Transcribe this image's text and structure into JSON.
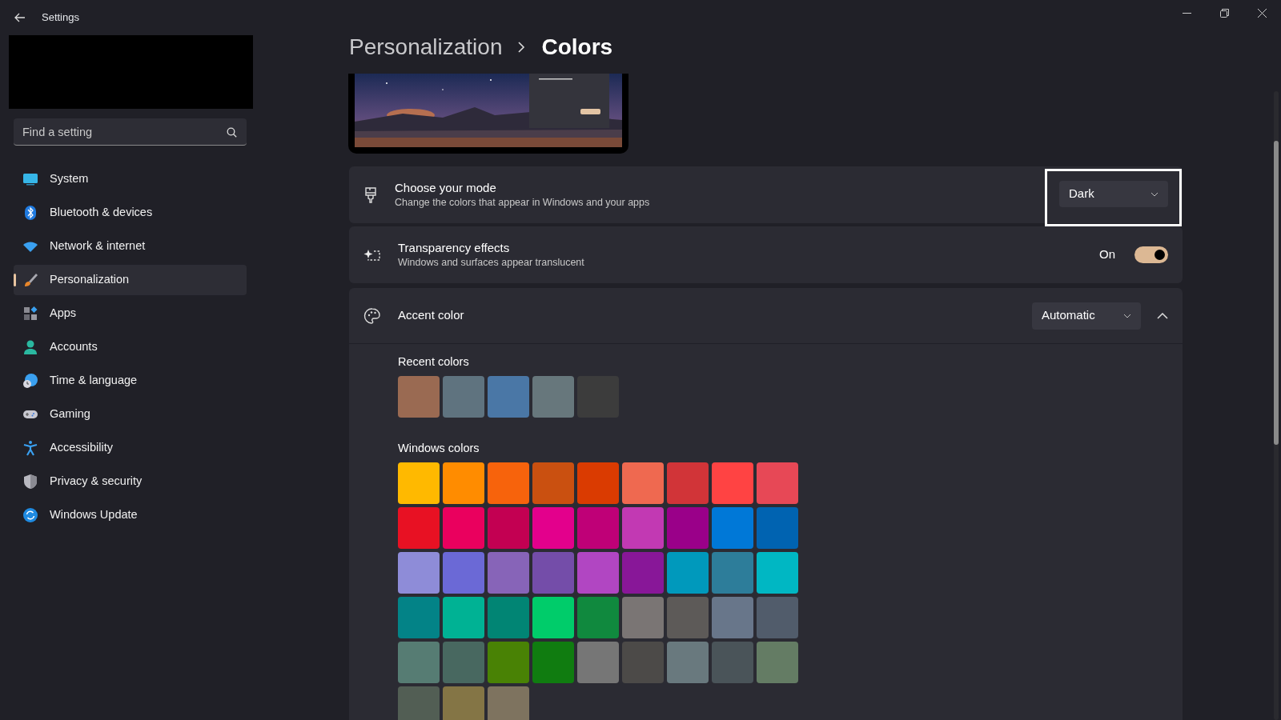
{
  "window": {
    "title": "Settings"
  },
  "search": {
    "placeholder": "Find a setting"
  },
  "nav": [
    {
      "label": "System",
      "selected": false
    },
    {
      "label": "Bluetooth & devices",
      "selected": false
    },
    {
      "label": "Network & internet",
      "selected": false
    },
    {
      "label": "Personalization",
      "selected": true
    },
    {
      "label": "Apps",
      "selected": false
    },
    {
      "label": "Accounts",
      "selected": false
    },
    {
      "label": "Time & language",
      "selected": false
    },
    {
      "label": "Gaming",
      "selected": false
    },
    {
      "label": "Accessibility",
      "selected": false
    },
    {
      "label": "Privacy & security",
      "selected": false
    },
    {
      "label": "Windows Update",
      "selected": false
    }
  ],
  "breadcrumb": [
    "Personalization",
    "Colors"
  ],
  "settings": [
    {
      "kind": "dropdown",
      "title": "Choose your mode",
      "description": "Change the colors that appear in Windows and your apps",
      "value": "Dark",
      "highlighted": true
    },
    {
      "kind": "toggle",
      "title": "Transparency effects",
      "description": "Windows and surfaces appear translucent",
      "state_label": "On",
      "on": true
    }
  ],
  "accent": {
    "title": "Accent color",
    "value": "Automatic",
    "expanded": true,
    "recent_label": "Recent colors",
    "recent": [
      {
        "color": "#9a6a52"
      },
      {
        "color": "#5f737f"
      },
      {
        "color": "#4a77a6"
      },
      {
        "color": "#67777c"
      },
      {
        "color": "#3c3c3c"
      }
    ],
    "windows_label": "Windows colors",
    "windows": [
      {
        "color": "#ffb900"
      },
      {
        "color": "#ff8c00"
      },
      {
        "color": "#f7630c"
      },
      {
        "color": "#ca5010"
      },
      {
        "color": "#da3b01"
      },
      {
        "color": "#ef6950"
      },
      {
        "color": "#d13438"
      },
      {
        "color": "#ff4343"
      },
      {
        "color": "#e74856"
      },
      {
        "color": "#e81123"
      },
      {
        "color": "#ea005e"
      },
      {
        "color": "#c30052"
      },
      {
        "color": "#e3008c"
      },
      {
        "color": "#bf0077"
      },
      {
        "color": "#c239b3"
      },
      {
        "color": "#9a0089"
      },
      {
        "color": "#0078d7"
      },
      {
        "color": "#0063b1"
      },
      {
        "color": "#8e8cd8"
      },
      {
        "color": "#6b69d6"
      },
      {
        "color": "#8764b8"
      },
      {
        "color": "#744da9"
      },
      {
        "color": "#b146c2"
      },
      {
        "color": "#881798"
      },
      {
        "color": "#0099bc"
      },
      {
        "color": "#2d7d9a"
      },
      {
        "color": "#00b7c3"
      },
      {
        "color": "#038387"
      },
      {
        "color": "#00b294"
      },
      {
        "color": "#018574"
      },
      {
        "color": "#00cc6a"
      },
      {
        "color": "#10893e"
      },
      {
        "color": "#7a7574"
      },
      {
        "color": "#5d5a58"
      },
      {
        "color": "#68768a"
      },
      {
        "color": "#515c6b"
      },
      {
        "color": "#567c73"
      },
      {
        "color": "#486860"
      },
      {
        "color": "#498205"
      },
      {
        "color": "#107c10"
      },
      {
        "color": "#767676"
      },
      {
        "color": "#4c4a48"
      },
      {
        "color": "#69797e"
      },
      {
        "color": "#4a5459"
      },
      {
        "color": "#647c64"
      },
      {
        "color": "#525e54"
      },
      {
        "color": "#847545"
      },
      {
        "color": "#7e735f"
      }
    ]
  }
}
